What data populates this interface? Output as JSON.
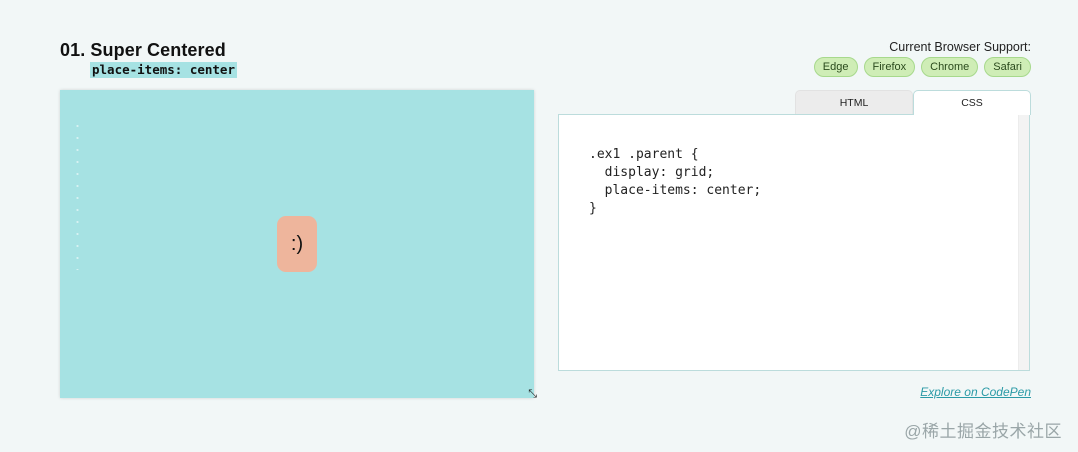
{
  "example": {
    "title": "01. Super Centered",
    "subtitle": "place-items: center",
    "demo_child_text": ":)",
    "resize_glyph": "⤡"
  },
  "support": {
    "label": "Current Browser Support:",
    "browsers": [
      "Edge",
      "Firefox",
      "Chrome",
      "Safari"
    ]
  },
  "tabs": [
    {
      "label": "HTML",
      "active": false
    },
    {
      "label": "CSS",
      "active": true
    }
  ],
  "code": {
    "css": ".ex1 .parent {\n  display: grid;\n  place-items: center;\n}"
  },
  "link": {
    "label": "Explore on CodePen"
  },
  "watermark": "@稀土掘金技术社区",
  "colors": {
    "background": "#f2f7f7",
    "demo_background": "#a6e2e3",
    "child_background": "#eeb59c",
    "badge_background": "#cfedb6",
    "link": "#2a9aa6"
  }
}
